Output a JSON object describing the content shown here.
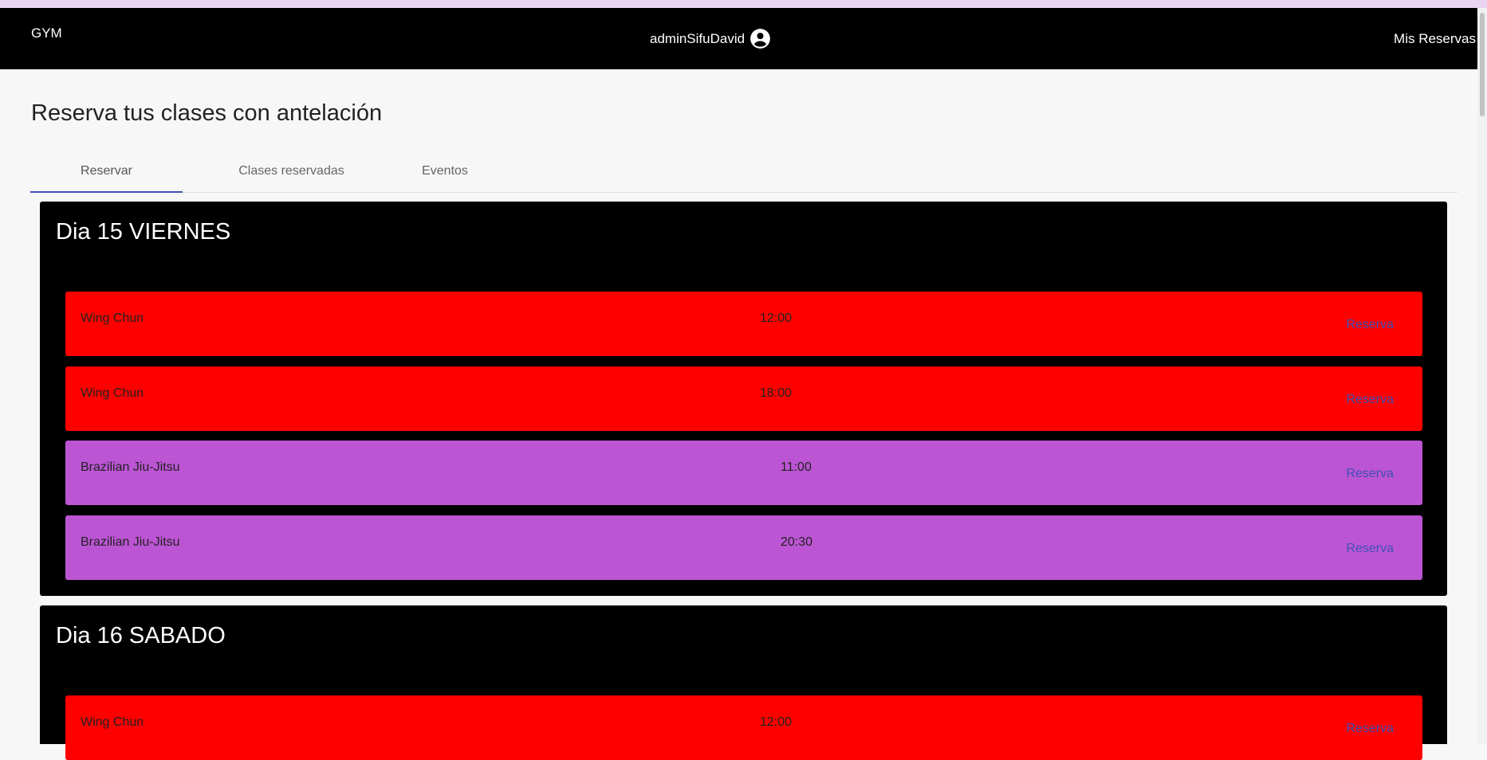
{
  "app": {
    "brand": "GYM",
    "username": "adminSifuDavid",
    "my_reservations": "Mis Reservas"
  },
  "page": {
    "title": "Reserva tus clases con antelación"
  },
  "tabs": [
    {
      "label": "Reservar",
      "active": true
    },
    {
      "label": "Clases reservadas",
      "active": false
    },
    {
      "label": "Eventos",
      "active": false
    }
  ],
  "days": [
    {
      "title": "Dia 15 VIERNES",
      "classes": [
        {
          "name": "Wing Chun",
          "time": "12:00",
          "color": "#ff0000",
          "action": "Reserva"
        },
        {
          "name": "Wing Chun",
          "time": "18:00",
          "color": "#ff0000",
          "action": "Reserva"
        },
        {
          "name": "Brazilian Jiu-Jitsu",
          "time": "11:00",
          "color": "#bc55d4",
          "action": "Reserva"
        },
        {
          "name": "Brazilian Jiu-Jitsu",
          "time": "20:30",
          "color": "#bc55d4",
          "action": "Reserva"
        }
      ]
    },
    {
      "title": "Dia 16 SABADO",
      "classes": [
        {
          "name": "Wing Chun",
          "time": "12:00",
          "color": "#ff0000",
          "action": "Reserva"
        }
      ]
    }
  ],
  "colors": {
    "accent": "#3f51b5",
    "header": "#000000",
    "wing_chun": "#ff0000",
    "bjj": "#bc55d4"
  },
  "icons": {
    "user": "account-circle-icon"
  }
}
